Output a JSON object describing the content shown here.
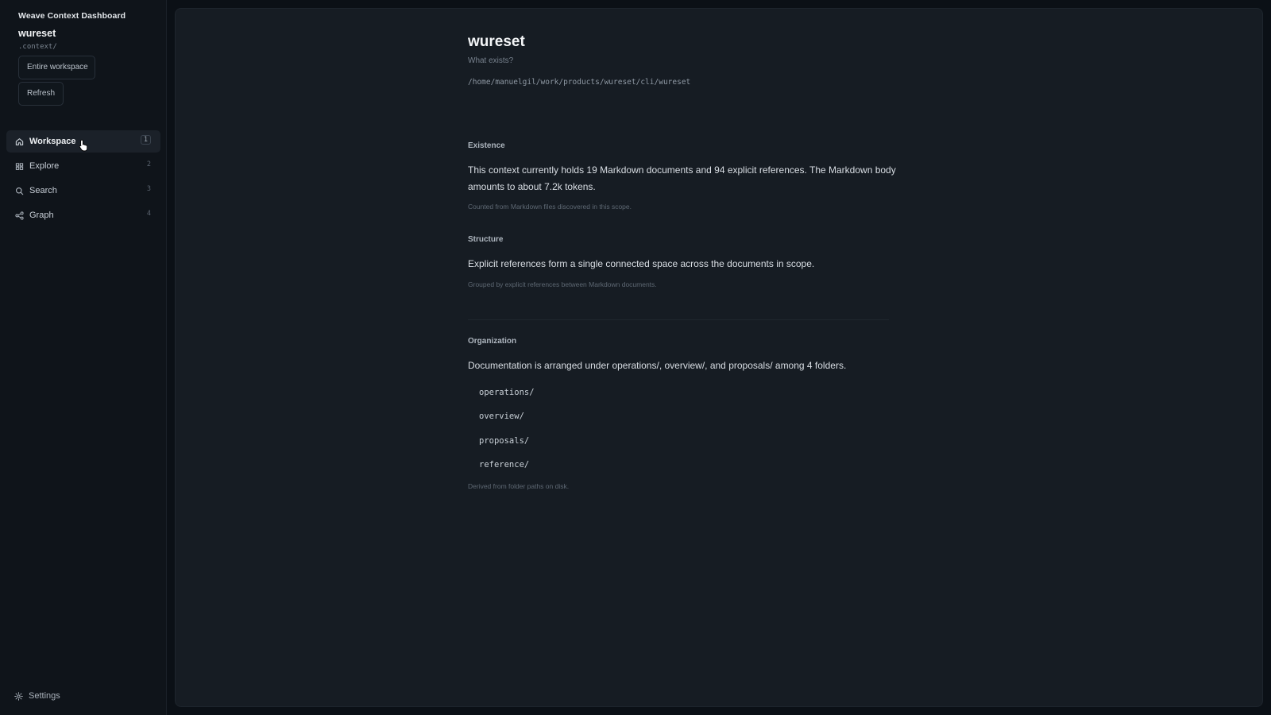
{
  "sidebar": {
    "app_title": "Weave Context Dashboard",
    "workspace_name": "wureset",
    "context_dir": ".context/",
    "buttons": {
      "entire_workspace": "Entire workspace",
      "refresh": "Refresh"
    },
    "nav": [
      {
        "label": "Workspace",
        "key": "1",
        "icon": "home-icon",
        "active": true
      },
      {
        "label": "Explore",
        "key": "2",
        "icon": "grid-icon",
        "active": false
      },
      {
        "label": "Search",
        "key": "3",
        "icon": "search-icon",
        "active": false
      },
      {
        "label": "Graph",
        "key": "4",
        "icon": "graph-icon",
        "active": false
      }
    ],
    "settings_label": "Settings"
  },
  "main": {
    "title": "wureset",
    "subtitle": "What exists?",
    "path": "/home/manuelgil/work/products/wureset/cli/wureset",
    "sections": {
      "existence": {
        "heading": "Existence",
        "body": "This context currently holds 19 Markdown documents and 94 explicit references. The Markdown body amounts to about 7.2k tokens.",
        "note": "Counted from Markdown files discovered in this scope."
      },
      "structure": {
        "heading": "Structure",
        "body": "Explicit references form a single connected space across the documents in scope.",
        "note": "Grouped by explicit references between Markdown documents."
      },
      "organization": {
        "heading": "Organization",
        "body": "Documentation is arranged under operations/, overview/, and proposals/ among 4 folders.",
        "folders": [
          "operations/",
          "overview/",
          "proposals/",
          "reference/"
        ],
        "note": "Derived from folder paths on disk."
      }
    }
  },
  "colors": {
    "background": "#0b1016",
    "sidebar": "#0f141a",
    "panel": "#161c23",
    "active_nav": "#1b2129"
  }
}
